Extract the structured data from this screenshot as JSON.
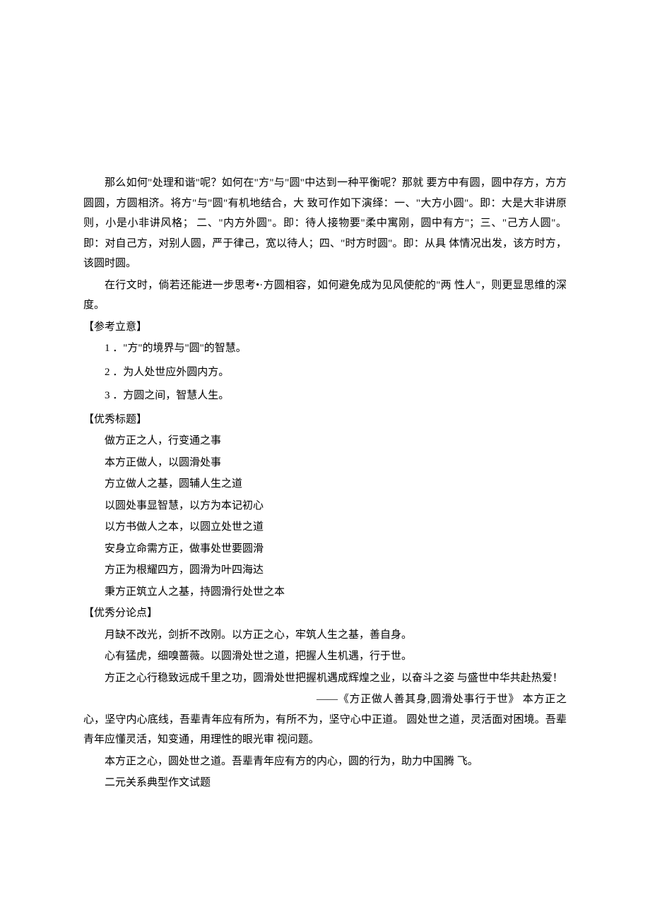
{
  "paragraphs": {
    "p1": "那么如何\"处理和谐\"呢？如何在\"方\"与\"圆\"中达到一种平衡呢？那就 要方中有圆，圆中存方，方方圆圆，方圆相济。将方\"与\"圆\"有机地结合，大 致可作如下演绎：一、\"大方小圆\"。即：大是大非讲原则，小是小非讲风格； 二、\"内方外圆\"。即：待人接物要\"柔中寓刚，圆中有方\"；三、\"己方人圆\"。 即：对自己方，对别人圆，严于律己，宽以待人；四、\"时方时圆\"。即：从具 体情况出发，该方时方，该圆时圆。",
    "p2": "在行文时，倘若还能进一步思考•·方圆相容，如何避免成为见风使舵的\"两    性人\"，则更显思维的深度。"
  },
  "sections": {
    "reference": {
      "label": "【参考立意】",
      "items": [
        "1 ．\"方\"的境界与\"圆\"的智慧。",
        "2 ．为人处世应外圆内方。",
        "3 ．方圆之间，智慧人生。"
      ]
    },
    "titles": {
      "label": "【优秀标题】",
      "items": [
        "做方正之人，行变通之事",
        "本方正做人，以圆滑处事",
        "方立做人之基，圆辅人生之道",
        "以圆处事显智慧，以方为本记初心",
        "以方书做人之本，以圆立处世之道",
        "安身立命需方正，做事处世要圆滑",
        "方正为根耀四方，圆滑为叶四海达",
        "秉方正筑立人之基，持圆滑行处世之本"
      ]
    },
    "subpoints": {
      "label": "【优秀分论点】",
      "items": [
        "月缺不改光，剑折不改刚。以方正之心，牢筑人生之基，善自身。",
        "心有猛虎，细嗅蔷薇。以圆滑处世之道，把握人生机遇，行于世。",
        "方正之心行稳致远成千里之功，圆滑处世把握机遇成辉煌之业，以奋斗之姿 与盛世中华共赴热爱！"
      ],
      "citation": "——《方正做人善其身,圆滑处事行于世》 本方正之心，坚守内心底线，吾辈青年应有所为，有所不为，坚守心中正道。 圆处世之道，灵活面对困境。吾辈青年应懂灵活，知变通，用理性的眼光审 视问题。",
      "tail1": "本方正之心，圆处世之道。吾辈青年应有方的内心，圆的行为，助力中国腾 飞。",
      "tail2": "二元关系典型作文试题"
    }
  }
}
